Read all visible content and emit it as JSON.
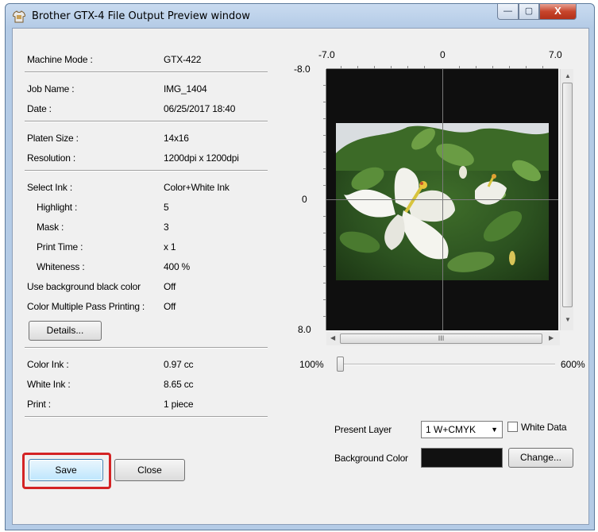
{
  "window": {
    "title": "Brother GTX-4 File Output Preview window"
  },
  "titlebar_buttons": {
    "minimize": "—",
    "maximize": "▢",
    "close": "X"
  },
  "info": {
    "machine_mode": {
      "label": "Machine Mode :",
      "value": "GTX-422"
    },
    "job_name": {
      "label": "Job Name :",
      "value": "IMG_1404"
    },
    "date": {
      "label": "Date :",
      "value": "06/25/2017 18:40"
    },
    "platen_size": {
      "label": "Platen Size :",
      "value": "14x16"
    },
    "resolution": {
      "label": "Resolution :",
      "value": "1200dpi x 1200dpi"
    },
    "select_ink": {
      "label": "Select Ink :",
      "value": "Color+White Ink"
    },
    "highlight": {
      "label": "Highlight :",
      "value": "5"
    },
    "mask": {
      "label": "Mask :",
      "value": "3"
    },
    "print_time": {
      "label": "Print Time :",
      "value": "x 1"
    },
    "whiteness": {
      "label": "Whiteness :",
      "value": "400 %"
    },
    "use_bg_black": {
      "label": "Use background black color",
      "value": "Off"
    },
    "color_multipass": {
      "label": "Color Multiple Pass Printing :",
      "value": "Off"
    },
    "color_ink": {
      "label": "Color Ink :",
      "value": "0.97 cc"
    },
    "white_ink": {
      "label": "White Ink :",
      "value": "8.65 cc"
    },
    "print": {
      "label": "Print :",
      "value": "1 piece"
    }
  },
  "buttons": {
    "details": "Details...",
    "save": "Save",
    "close": "Close",
    "change": "Change..."
  },
  "preview": {
    "x_axis": {
      "min": "-7.0",
      "mid": "0",
      "max": "7.0"
    },
    "y_axis": {
      "min": "-8.0",
      "mid": "0",
      "max": "8.0"
    },
    "scroll_grip": "III"
  },
  "zoom": {
    "min_label": "100%",
    "max_label": "600%",
    "level_fraction": 0
  },
  "present_layer": {
    "label": "Present Layer",
    "value": "1 W+CMYK"
  },
  "white_data": {
    "label": "White Data",
    "checked": false
  },
  "background_color": {
    "label": "Background Color",
    "color": "#111111"
  },
  "colors": {
    "highlight_border": "#d42324",
    "canvas_bg": "#0f0f0f"
  }
}
